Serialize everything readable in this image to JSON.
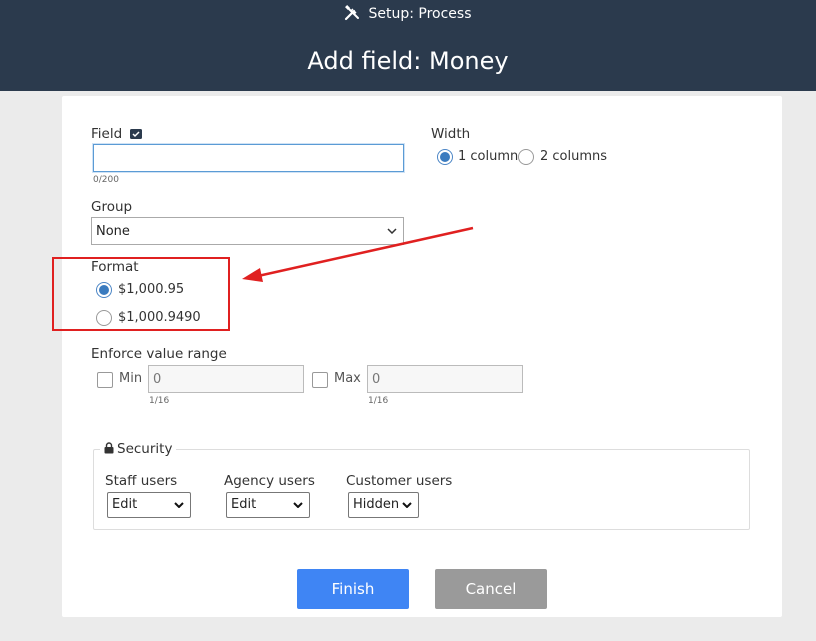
{
  "header": {
    "breadcrumb": "Setup: Process",
    "title": "Add field: Money"
  },
  "form": {
    "field": {
      "label": "Field",
      "value": "",
      "counter": "0/200"
    },
    "width": {
      "label": "Width",
      "options": [
        "1 column",
        "2 columns"
      ],
      "selected": "1 column"
    },
    "group": {
      "label": "Group",
      "value": "None"
    },
    "format": {
      "label": "Format",
      "options": [
        "$1,000.95",
        "$1,000.9490"
      ],
      "selected": "$1,000.95"
    },
    "range": {
      "label": "Enforce value range",
      "min": {
        "label": "Min",
        "value": "0",
        "counter": "1/16"
      },
      "max": {
        "label": "Max",
        "value": "0",
        "counter": "1/16"
      }
    },
    "security": {
      "legend": "Security",
      "staff": {
        "label": "Staff users",
        "value": "Edit"
      },
      "agency": {
        "label": "Agency users",
        "value": "Edit"
      },
      "customer": {
        "label": "Customer users",
        "value": "Hidden"
      }
    }
  },
  "buttons": {
    "finish": "Finish",
    "cancel": "Cancel"
  },
  "colors": {
    "header_bg": "#2b3a4d",
    "finish": "#3f85f4",
    "cancel": "#9a9a9a",
    "annotation": "#e02020"
  }
}
